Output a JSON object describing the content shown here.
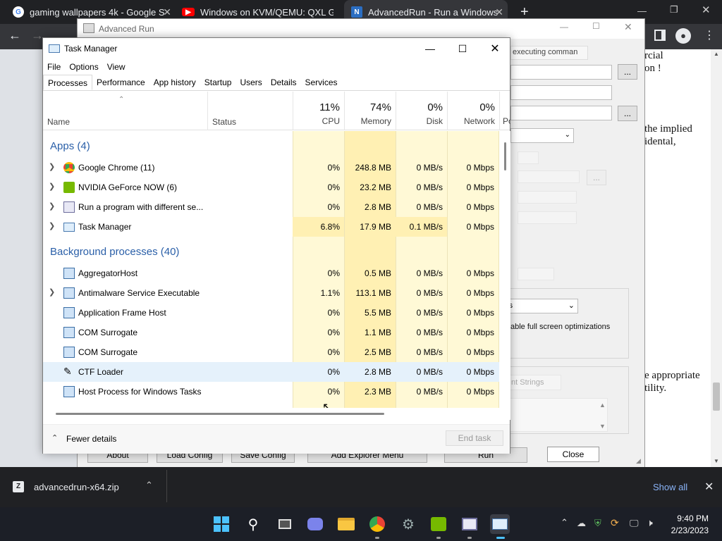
{
  "chrome": {
    "tabs": [
      {
        "title": "gaming wallpapers 4k - Google S"
      },
      {
        "title": "Windows on KVM/QEMU: QXL G"
      },
      {
        "title": "AdvancedRun - Run a Windows"
      }
    ],
    "new_tab": "+"
  },
  "webpage": {
    "lines": [
      "rcial",
      "on !",
      "the implied",
      "idental,",
      "e appropriate",
      "tility."
    ]
  },
  "advanced_run": {
    "title": "Advanced Run",
    "run_as_select": "executing comman",
    "browse": "...",
    "compat_label": "able full screen optimizations",
    "select_s": "rs",
    "env_label": "nt Strings",
    "buttons": [
      "About",
      "Load Config",
      "Save Config",
      "Add Explorer Menu",
      "Run",
      "Close"
    ]
  },
  "task_manager": {
    "title": "Task Manager",
    "menu": [
      "File",
      "Options",
      "View"
    ],
    "tabs": [
      "Processes",
      "Performance",
      "App history",
      "Startup",
      "Users",
      "Details",
      "Services"
    ],
    "columns": {
      "name": "Name",
      "status": "Status",
      "cpu_pct": "11%",
      "cpu": "CPU",
      "mem_pct": "74%",
      "mem": "Memory",
      "disk_pct": "0%",
      "disk": "Disk",
      "net_pct": "0%",
      "net": "Network",
      "power": "Po"
    },
    "apps_group": "Apps (4)",
    "bg_group": "Background processes (40)",
    "apps": [
      {
        "name": "Google Chrome (11)",
        "cpu": "0%",
        "mem": "248.8 MB",
        "disk": "0 MB/s",
        "net": "0 Mbps"
      },
      {
        "name": "NVIDIA GeForce NOW (6)",
        "cpu": "0%",
        "mem": "23.2 MB",
        "disk": "0 MB/s",
        "net": "0 Mbps"
      },
      {
        "name": "Run a program with different se...",
        "cpu": "0%",
        "mem": "2.8 MB",
        "disk": "0 MB/s",
        "net": "0 Mbps"
      },
      {
        "name": "Task Manager",
        "cpu": "6.8%",
        "mem": "17.9 MB",
        "disk": "0.1 MB/s",
        "net": "0 Mbps"
      }
    ],
    "background": [
      {
        "name": "AggregatorHost",
        "cpu": "0%",
        "mem": "0.5 MB",
        "disk": "0 MB/s",
        "net": "0 Mbps"
      },
      {
        "name": "Antimalware Service Executable",
        "cpu": "1.1%",
        "mem": "113.1 MB",
        "disk": "0 MB/s",
        "net": "0 Mbps"
      },
      {
        "name": "Application Frame Host",
        "cpu": "0%",
        "mem": "5.5 MB",
        "disk": "0 MB/s",
        "net": "0 Mbps"
      },
      {
        "name": "COM Surrogate",
        "cpu": "0%",
        "mem": "1.1 MB",
        "disk": "0 MB/s",
        "net": "0 Mbps"
      },
      {
        "name": "COM Surrogate",
        "cpu": "0%",
        "mem": "2.5 MB",
        "disk": "0 MB/s",
        "net": "0 Mbps"
      },
      {
        "name": "CTF Loader",
        "cpu": "0%",
        "mem": "2.8 MB",
        "disk": "0 MB/s",
        "net": "0 Mbps"
      },
      {
        "name": "Host Process for Windows Tasks",
        "cpu": "0%",
        "mem": "2.3 MB",
        "disk": "0 MB/s",
        "net": "0 Mbps"
      }
    ],
    "fewer_details": "Fewer details",
    "end_task": "End task"
  },
  "download_bar": {
    "file": "advancedrun-x64.zip",
    "show_all": "Show all"
  },
  "taskbar": {
    "time": "9:40 PM",
    "date": "2/23/2023"
  },
  "colors": {
    "heat_light": "#fff9d6",
    "heat_med": "#fff0b3",
    "heat_high": "#ffe7a0",
    "group_blue": "#2a5fa8"
  }
}
